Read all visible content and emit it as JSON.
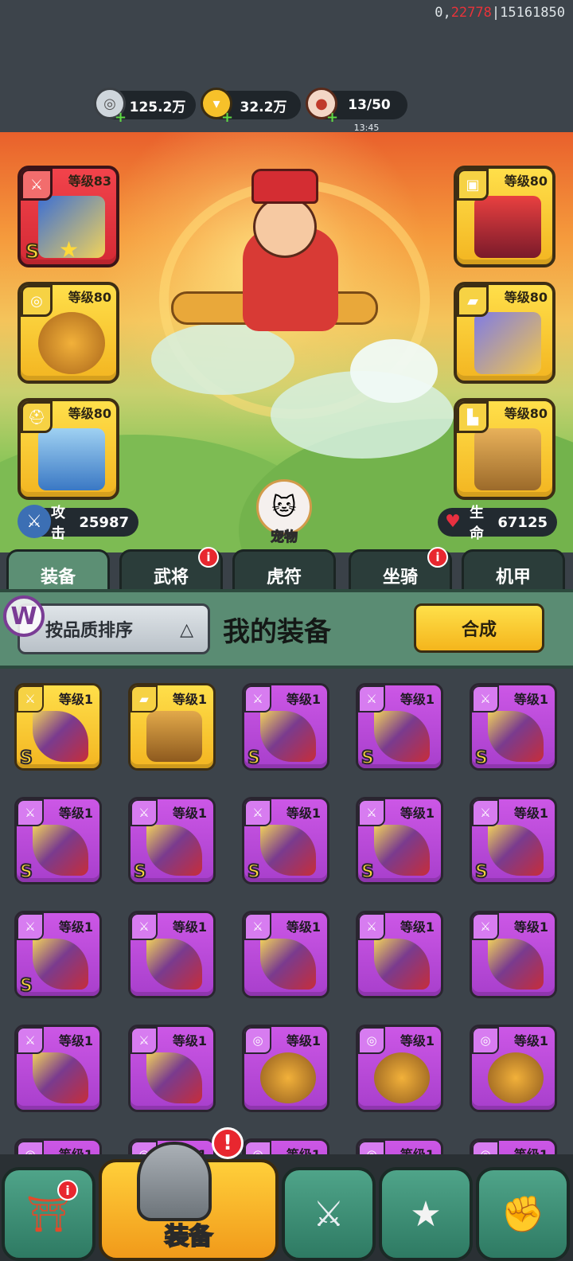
{
  "debug": {
    "prefix": "0,",
    "red": "22778",
    "suffix": "|15161850"
  },
  "currencies": [
    {
      "icon": "silver-coin-icon",
      "value": "125.2万"
    },
    {
      "icon": "gold-ingot-icon",
      "value": "32.2万"
    },
    {
      "icon": "meat-stamina-icon",
      "value": "13/50",
      "timer": "13:45"
    }
  ],
  "equipped": {
    "weapon": {
      "level": "等级83",
      "grade": "S",
      "star": "★"
    },
    "amulet": {
      "level": "等级80"
    },
    "helmet": {
      "level": "等级80"
    },
    "armor": {
      "level": "等级80"
    },
    "bracer": {
      "level": "等级80"
    },
    "boots": {
      "level": "等级80"
    }
  },
  "stats": {
    "attack": {
      "label": "攻击",
      "value": "25987"
    },
    "hp": {
      "label": "生命",
      "value": "67125"
    }
  },
  "pet": {
    "label": "宠物"
  },
  "tabs": [
    {
      "label": "装备",
      "active": true,
      "alert": false
    },
    {
      "label": "武将",
      "active": false,
      "alert": true
    },
    {
      "label": "虎符",
      "active": false,
      "alert": false
    },
    {
      "label": "坐骑",
      "active": false,
      "alert": true
    },
    {
      "label": "机甲",
      "active": false,
      "alert": false
    }
  ],
  "header": {
    "sort_label": "按品质排序",
    "title": "我的装备",
    "merge_label": "合成",
    "logo": "W"
  },
  "alert_glyph": "i",
  "items": [
    {
      "level": "等级1",
      "rarity": "gold",
      "type": "sword",
      "grade": "S"
    },
    {
      "level": "等级1",
      "rarity": "gold",
      "type": "bracer",
      "grade": ""
    },
    {
      "level": "等级1",
      "rarity": "purple",
      "type": "sword",
      "grade": "S"
    },
    {
      "level": "等级1",
      "rarity": "purple",
      "type": "sword",
      "grade": "S"
    },
    {
      "level": "等级1",
      "rarity": "purple",
      "type": "sword",
      "grade": "S"
    },
    {
      "level": "等级1",
      "rarity": "purple",
      "type": "sword",
      "grade": "S"
    },
    {
      "level": "等级1",
      "rarity": "purple",
      "type": "sword",
      "grade": "S"
    },
    {
      "level": "等级1",
      "rarity": "purple",
      "type": "sword",
      "grade": "S"
    },
    {
      "level": "等级1",
      "rarity": "purple",
      "type": "sword",
      "grade": "S"
    },
    {
      "level": "等级1",
      "rarity": "purple",
      "type": "sword",
      "grade": "S"
    },
    {
      "level": "等级1",
      "rarity": "purple",
      "type": "sword",
      "grade": "S"
    },
    {
      "level": "等级1",
      "rarity": "purple",
      "type": "sword",
      "grade": ""
    },
    {
      "level": "等级1",
      "rarity": "purple",
      "type": "sword",
      "grade": ""
    },
    {
      "level": "等级1",
      "rarity": "purple",
      "type": "sword",
      "grade": ""
    },
    {
      "level": "等级1",
      "rarity": "purple",
      "type": "sword",
      "grade": ""
    },
    {
      "level": "等级1",
      "rarity": "purple",
      "type": "sword",
      "grade": ""
    },
    {
      "level": "等级1",
      "rarity": "purple",
      "type": "sword",
      "grade": ""
    },
    {
      "level": "等级1",
      "rarity": "purple",
      "type": "amulet",
      "grade": ""
    },
    {
      "level": "等级1",
      "rarity": "purple",
      "type": "amulet",
      "grade": ""
    },
    {
      "level": "等级1",
      "rarity": "purple",
      "type": "amulet",
      "grade": ""
    },
    {
      "level": "等级1",
      "rarity": "purple",
      "type": "amulet",
      "grade": ""
    },
    {
      "level": "等级1",
      "rarity": "purple",
      "type": "amulet",
      "grade": ""
    },
    {
      "level": "等级1",
      "rarity": "purple",
      "type": "amulet",
      "grade": ""
    },
    {
      "level": "等级1",
      "rarity": "purple",
      "type": "amulet",
      "grade": ""
    },
    {
      "level": "等级1",
      "rarity": "purple",
      "type": "amulet",
      "grade": ""
    }
  ],
  "nav": [
    {
      "icon": "castle-icon",
      "label": "",
      "alert": true,
      "active": false
    },
    {
      "icon": "helmet-icon",
      "label": "装备",
      "alert": true,
      "active": true
    },
    {
      "icon": "crossed-swords-shield-icon",
      "label": "",
      "alert": false,
      "active": false
    },
    {
      "icon": "rooster-rank-icon",
      "label": "",
      "alert": false,
      "active": false
    },
    {
      "icon": "fist-upgrade-icon",
      "label": "",
      "alert": false,
      "active": false
    }
  ],
  "colors": {
    "purple": "#b548d8",
    "gold": "#f6c52c",
    "tab_active": "#5c8f74",
    "alert": "#e8272f"
  }
}
